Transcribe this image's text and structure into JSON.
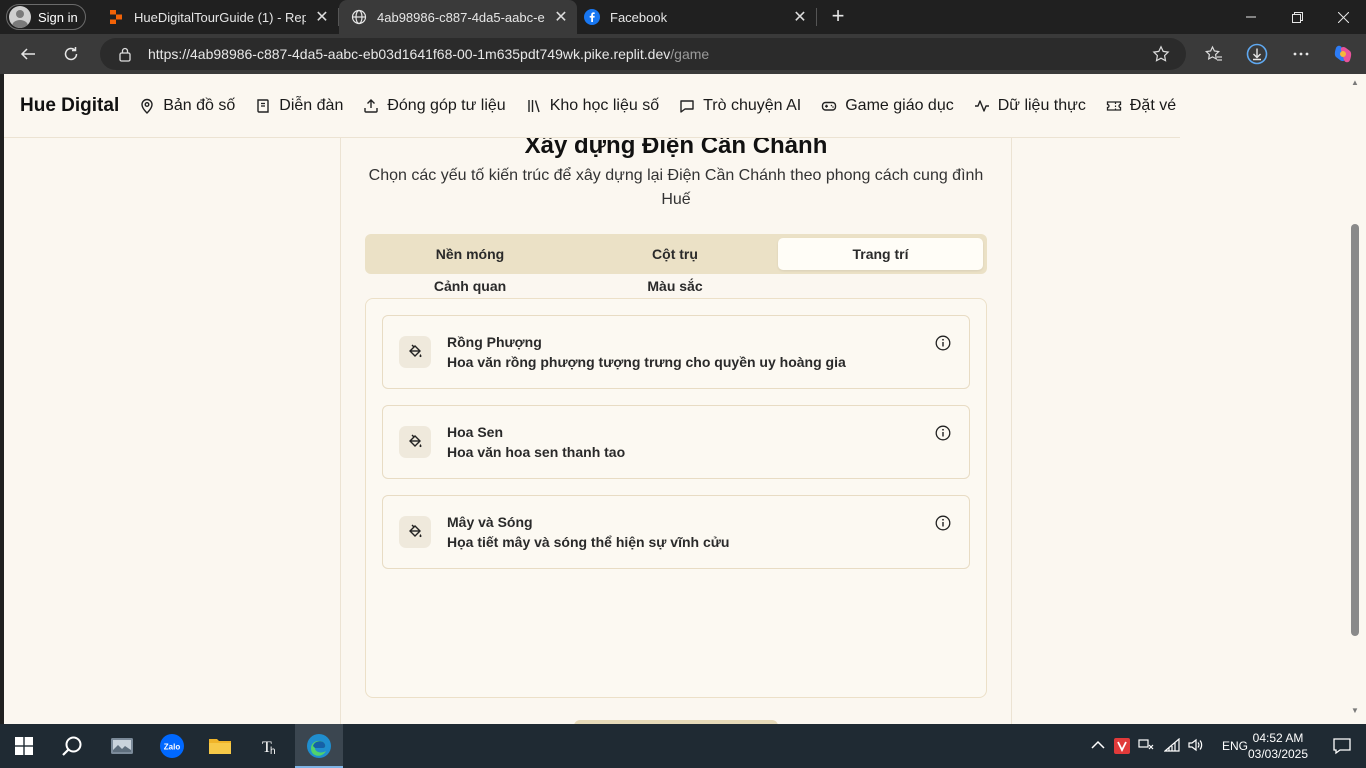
{
  "browser": {
    "signin_label": "Sign in",
    "tabs": [
      {
        "title": "HueDigitalTourGuide (1) - Replit",
        "icon": "replit-icon"
      },
      {
        "title": "4ab98986-c887-4da5-aabc-eb03d",
        "icon": "globe-icon"
      },
      {
        "title": "Facebook",
        "icon": "facebook-icon"
      }
    ],
    "url_host": "https://4ab98986-c887-4da5-aabc-eb03d1641f68-00-1m635pdt749wk.pike.replit.dev",
    "url_path": "/game"
  },
  "app": {
    "brand": "Hue Digital",
    "nav": [
      {
        "label": "Bản đồ số",
        "icon": "map-pin-icon"
      },
      {
        "label": "Diễn đàn",
        "icon": "book-icon"
      },
      {
        "label": "Đóng góp tư liệu",
        "icon": "upload-icon"
      },
      {
        "label": "Kho học liệu số",
        "icon": "library-icon"
      },
      {
        "label": "Trò chuyện AI",
        "icon": "chat-icon"
      },
      {
        "label": "Game giáo dục",
        "icon": "gamepad-icon"
      },
      {
        "label": "Dữ liệu thực",
        "icon": "activity-icon"
      },
      {
        "label": "Đặt vé",
        "icon": "ticket-icon"
      }
    ]
  },
  "game": {
    "title": "Xây dựng Điện Cần Chánh",
    "description": "Chọn các yếu tố kiến trúc để xây dựng lại Điện Cần Chánh theo phong cách cung đình Huế",
    "tabs": [
      "Nền móng",
      "Cột trụ",
      "Trang trí",
      "Cảnh quan",
      "Màu sắc"
    ],
    "active_tab": "Trang trí",
    "items": [
      {
        "name": "Rồng Phượng",
        "desc": "Hoa văn rồng phượng tượng trưng cho quyền uy hoàng gia"
      },
      {
        "name": "Hoa Sen",
        "desc": "Hoa văn hoa sen thanh tao"
      },
      {
        "name": "Mây và Sóng",
        "desc": "Họa tiết mây và sóng thể hiện sự vĩnh cửu"
      }
    ]
  },
  "taskbar": {
    "language": "ENG",
    "time": "04:52 AM",
    "date": "03/03/2025"
  }
}
